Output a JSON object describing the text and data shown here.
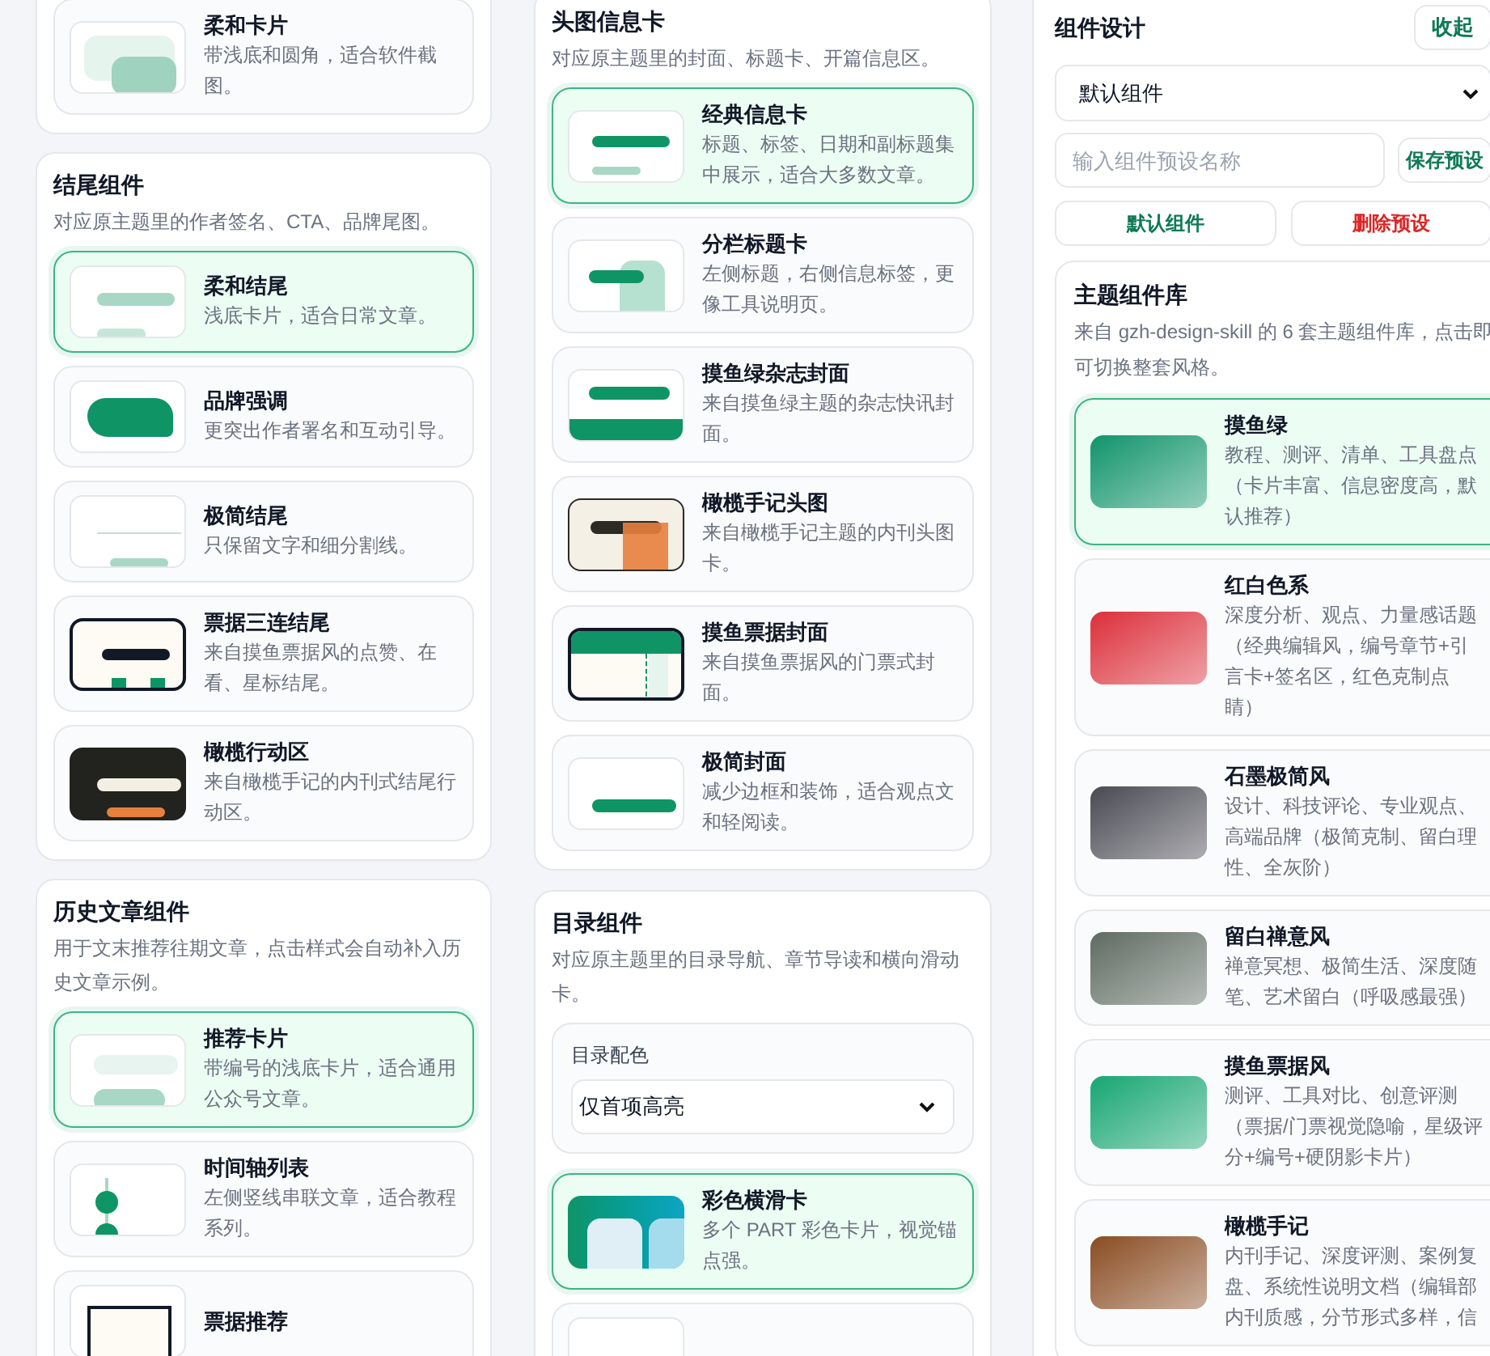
{
  "left_column": {
    "panels": [
      {
        "cards": [
          {
            "title": "柔和卡片",
            "description": "带浅底和圆角，适合软件截图。",
            "kind": "soft-card",
            "selected": false
          }
        ]
      },
      {
        "title": "结尾组件",
        "description": "对应原主题里的作者签名、CTA、品牌尾图。",
        "cards": [
          {
            "title": "柔和结尾",
            "description": "浅底卡片，适合日常文章。",
            "kind": "soft-end",
            "selected": true
          },
          {
            "title": "品牌强调",
            "description": "更突出作者署名和互动引导。",
            "kind": "brand",
            "selected": false
          },
          {
            "title": "极简结尾",
            "description": "只保留文字和细分割线。",
            "kind": "minimal-end",
            "selected": false
          },
          {
            "title": "票据三连结尾",
            "description": "来自摸鱼票据风的点赞、在看、星标结尾。",
            "kind": "ticket-end",
            "selected": false
          },
          {
            "title": "橄榄行动区",
            "description": "来自橄榄手记的内刊式结尾行动区。",
            "kind": "olive-action",
            "selected": false
          }
        ]
      },
      {
        "title": "历史文章组件",
        "description": "用于文末推荐往期文章，点击样式会自动补入历史文章示例。",
        "cards": [
          {
            "title": "推荐卡片",
            "description": "带编号的浅底卡片，适合通用公众号文章。",
            "kind": "recommend",
            "selected": true
          },
          {
            "title": "时间轴列表",
            "description": "左侧竖线串联文章，适合教程系列。",
            "kind": "timeline",
            "selected": false
          },
          {
            "title": "票据推荐",
            "kind": "ticket-recommend",
            "selected": false
          }
        ]
      }
    ]
  },
  "middle_column": {
    "panels": [
      {
        "title": "头图信息卡",
        "description": "对应原主题里的封面、标题卡、开篇信息区。",
        "cards": [
          {
            "title": "经典信息卡",
            "description": "标题、标签、日期和副标题集中展示，适合大多数文章。",
            "kind": "classic",
            "selected": true
          },
          {
            "title": "分栏标题卡",
            "description": "左侧标题，右侧信息标签，更像工具说明页。",
            "kind": "split",
            "selected": false
          },
          {
            "title": "摸鱼绿杂志封面",
            "description": "来自摸鱼绿主题的杂志快讯封面。",
            "kind": "magazine",
            "selected": false
          },
          {
            "title": "橄榄手记头图",
            "description": "来自橄榄手记主题的内刊头图卡。",
            "kind": "olive-head",
            "selected": false
          },
          {
            "title": "摸鱼票据封面",
            "description": "来自摸鱼票据风的门票式封面。",
            "kind": "ticket-cover",
            "selected": false
          },
          {
            "title": "极简封面",
            "description": "减少边框和装饰，适合观点文和轻阅读。",
            "kind": "minimal-cover",
            "selected": false
          }
        ]
      },
      {
        "title": "目录组件",
        "description": "对应原主题里的目录导航、章节导读和横向滑动卡。",
        "color_select": {
          "label": "目录配色",
          "value": "仅首项高亮"
        },
        "cards": [
          {
            "title": "彩色横滑卡",
            "description": "多个 PART 彩色卡片，视觉锚点强。",
            "kind": "color-scroll",
            "selected": true
          },
          {
            "kind": "plain",
            "selected": false
          }
        ]
      }
    ]
  },
  "design_panel": {
    "title": "组件设计",
    "collapse_button": "收起",
    "preset_select": "默认组件",
    "preset_name_field": {
      "placeholder": "输入组件预设名称"
    },
    "save_button": "保存预设",
    "default_button": "默认组件",
    "delete_button": "删除预设",
    "library": {
      "title": "主题组件库",
      "description": "来自 gzh-design-skill 的 6 套主题组件库，点击即可切换整套风格。",
      "themes": [
        {
          "name": "摸鱼绿",
          "description": "教程、测评、清单、工具盘点（卡片丰富、信息密度高，默认推荐）",
          "color": "#11946a",
          "selected": true
        },
        {
          "name": "红白色系",
          "description": "深度分析、观点、力量感话题（经典编辑风，编号章节+引言卡+签名区，红色克制点睛）",
          "color": "#dc2f3a",
          "selected": false
        },
        {
          "name": "石墨极简风",
          "description": "设计、科技评论、专业观点、高端品牌（极简克制、留白理性、全灰阶）",
          "color": "#4a4a54",
          "selected": false
        },
        {
          "name": "留白禅意风",
          "description": "禅意冥想、极简生活、深度随笔、艺术留白（呼吸感最强）",
          "color": "#5f6b62",
          "selected": false
        },
        {
          "name": "摸鱼票据风",
          "description": "测评、工具对比、创意评测（票据/门票视觉隐喻，星级评分+编号+硬阴影卡片）",
          "color": "#17a673",
          "selected": false
        },
        {
          "name": "橄榄手记",
          "description": "内刊手记、深度评测、案例复盘、系统性说明文档（编辑部内刊质感，分节形式多样，信",
          "color": "#8a4c22",
          "selected": false
        }
      ]
    }
  }
}
